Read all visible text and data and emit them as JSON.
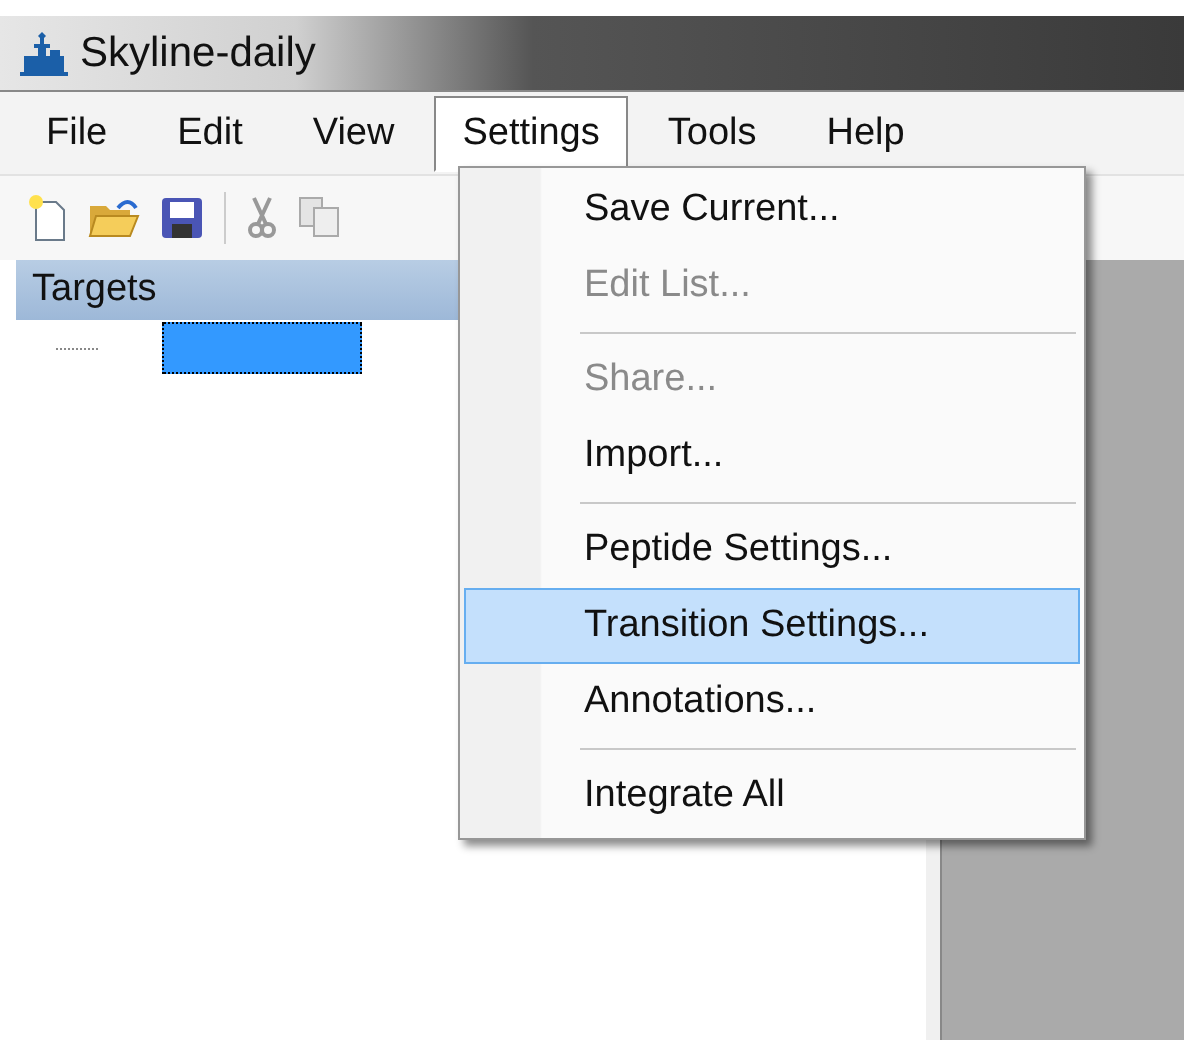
{
  "window": {
    "title": "Skyline-daily"
  },
  "menu_bar": [
    {
      "label": "File",
      "selected": false
    },
    {
      "label": "Edit",
      "selected": false
    },
    {
      "label": "View",
      "selected": false
    },
    {
      "label": "Settings",
      "selected": true
    },
    {
      "label": "Tools",
      "selected": false
    },
    {
      "label": "Help",
      "selected": false
    }
  ],
  "targets_panel": {
    "title": "Targets",
    "tree": [
      {
        "kind": "node",
        "selected": true
      }
    ]
  },
  "settings_menu": [
    {
      "kind": "item",
      "label": "Save Current...",
      "disabled": false,
      "selected": false
    },
    {
      "kind": "item",
      "label": "Edit List...",
      "disabled": true,
      "selected": false
    },
    {
      "kind": "separator"
    },
    {
      "kind": "item",
      "label": "Share...",
      "disabled": true,
      "selected": false
    },
    {
      "kind": "item",
      "label": "Import...",
      "disabled": false,
      "selected": false
    },
    {
      "kind": "separator"
    },
    {
      "kind": "item",
      "label": "Peptide Settings...",
      "disabled": false,
      "selected": false
    },
    {
      "kind": "item",
      "label": "Transition Settings...",
      "disabled": false,
      "selected": true
    },
    {
      "kind": "item",
      "label": "Annotations...",
      "disabled": false,
      "selected": false
    },
    {
      "kind": "separator"
    },
    {
      "kind": "item",
      "label": "Integrate All",
      "disabled": false,
      "selected": false
    }
  ]
}
